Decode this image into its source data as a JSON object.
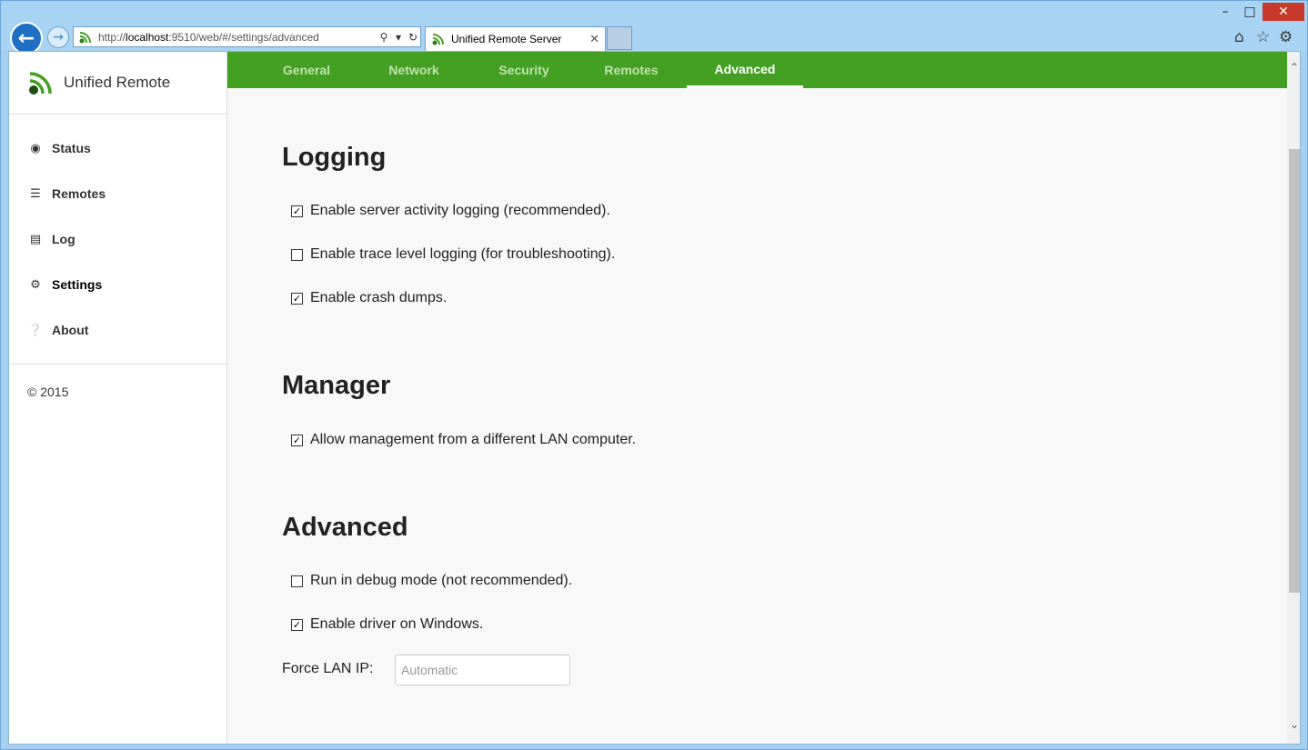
{
  "browser": {
    "url_prefix": "http://",
    "url_host": "localhost",
    "url_rest": ":9510/web/#/settings/advanced",
    "tab_title": "Unified Remote Server",
    "back_icon": "back-arrow-icon",
    "forward_icon": "forward-arrow-icon"
  },
  "sidebar": {
    "brand": "Unified Remote",
    "items": [
      {
        "label": "Status",
        "icon": "dashboard-icon"
      },
      {
        "label": "Remotes",
        "icon": "list-icon"
      },
      {
        "label": "Log",
        "icon": "file-icon"
      },
      {
        "label": "Settings",
        "icon": "gear-icon",
        "active": true
      },
      {
        "label": "About",
        "icon": "question-icon"
      }
    ],
    "copyright": "© 2015"
  },
  "tabs": [
    {
      "label": "General"
    },
    {
      "label": "Network"
    },
    {
      "label": "Security"
    },
    {
      "label": "Remotes"
    },
    {
      "label": "Advanced",
      "active": true
    }
  ],
  "sections": {
    "logging": {
      "title": "Logging",
      "options": [
        {
          "label": "Enable server activity logging (recommended).",
          "checked": true
        },
        {
          "label": "Enable trace level logging (for troubleshooting).",
          "checked": false
        },
        {
          "label": "Enable crash dumps.",
          "checked": true
        }
      ]
    },
    "manager": {
      "title": "Manager",
      "options": [
        {
          "label": "Allow management from a different LAN computer.",
          "checked": true
        }
      ]
    },
    "advanced": {
      "title": "Advanced",
      "options": [
        {
          "label": "Run in debug mode (not recommended).",
          "checked": false
        },
        {
          "label": "Enable driver on Windows.",
          "checked": true
        }
      ],
      "force_lan_ip_label": "Force LAN IP:",
      "force_lan_ip_placeholder": "Automatic",
      "force_lan_ip_value": ""
    }
  },
  "colors": {
    "accent_green": "#43a022",
    "browser_blue": "#a9d3f3"
  }
}
